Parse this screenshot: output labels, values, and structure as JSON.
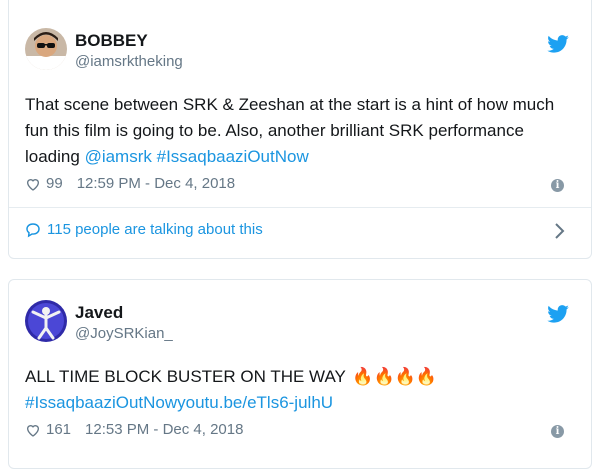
{
  "tweets": [
    {
      "name": "BOBBEY",
      "handle": "@iamsrktheking",
      "text": "That scene between SRK & Zeeshan at the start is a hint of how much fun this film is going to be. Also, another brilliant SRK performance loading ",
      "mention": "@iamsrk",
      "hashtag": "#IssaqbaaziOutNow",
      "likes": "99",
      "timestamp": "12:59 PM - Dec 4, 2018",
      "talking": "115 people are talking about this"
    },
    {
      "name": "Javed",
      "handle": "@JoySRKian_",
      "text": "ALL TIME BLOCK BUSTER ON THE WAY ",
      "emoji": "🔥🔥🔥🔥",
      "link": "#IssaqbaaziOutNowyoutu.be/eTls6-julhU",
      "likes": "161",
      "timestamp": "12:53 PM - Dec 4, 2018"
    }
  ],
  "colors": {
    "accent": "#1b95e0",
    "muted": "#657786",
    "border": "#e1e8ed"
  },
  "icons": [
    "avatar",
    "twitter-bird-icon",
    "heart-icon",
    "info-icon",
    "comment-bubble-icon",
    "chevron-right-icon",
    "fire-emoji"
  ]
}
